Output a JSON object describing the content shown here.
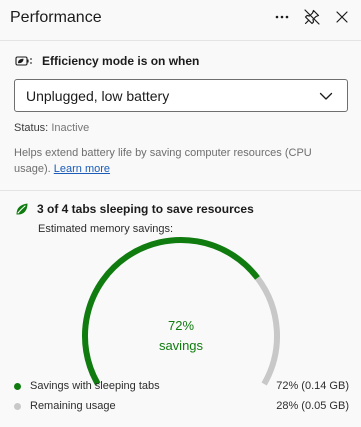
{
  "header": {
    "title": "Performance",
    "more_icon": "more-horizontal-icon",
    "unpin_icon": "unpin-icon",
    "close_icon": "close-icon"
  },
  "efficiency": {
    "label": "Efficiency mode is on when",
    "icon": "battery-leaf-icon",
    "dropdown_value": "Unplugged, low battery",
    "status_label": "Status:",
    "status_value": "Inactive",
    "description": "Helps extend battery life by saving computer resources (CPU usage).",
    "learn_more": "Learn more"
  },
  "sleeping_tabs": {
    "icon": "leaf-icon",
    "title": "3 of 4 tabs sleeping to save resources",
    "subtitle": "Estimated memory savings:",
    "percent_text": "72%",
    "savings_text": "savings",
    "fraction_saved": 0.72
  },
  "legend": [
    {
      "label": "Savings with sleeping tabs",
      "value": "72% (0.14 GB)",
      "color": "#107c10"
    },
    {
      "label": "Remaining usage",
      "value": "28% (0.05 GB)",
      "color": "#c8c8c8"
    }
  ],
  "colors": {
    "accent": "#107c10",
    "remaining": "#c8c8c8",
    "link": "#1b5cb8"
  }
}
